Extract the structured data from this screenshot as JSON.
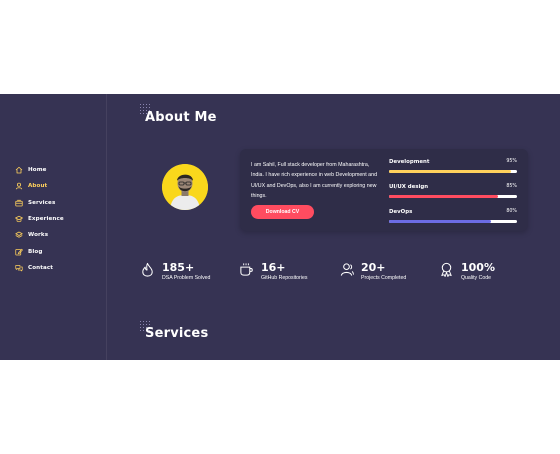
{
  "nav": {
    "items": [
      {
        "label": "Home",
        "icon": "house-icon",
        "active": false
      },
      {
        "label": "About",
        "icon": "user-icon",
        "active": true
      },
      {
        "label": "Services",
        "icon": "briefcase-icon",
        "active": false
      },
      {
        "label": "Experience",
        "icon": "graduation-cap-icon",
        "active": false
      },
      {
        "label": "Works",
        "icon": "layers-icon",
        "active": false
      },
      {
        "label": "Blog",
        "icon": "edit-icon",
        "active": false
      },
      {
        "label": "Contact",
        "icon": "chat-bubbles-icon",
        "active": false
      }
    ]
  },
  "about": {
    "title": "About Me",
    "bio": "I am Sahil, Full stack developer from Maharashtra, India. I have rich experience in web Development and UI/UX and DevOps, also I am currently exploring new things.",
    "cv_button": "Download CV",
    "skills": [
      {
        "name": "Development",
        "percent_label": "95%",
        "percent": 95,
        "color": "#ffd15c"
      },
      {
        "name": "UI/UX design",
        "percent_label": "85%",
        "percent": 85,
        "color": "#ff4c60"
      },
      {
        "name": "DevOps",
        "percent_label": "80%",
        "percent": 80,
        "color": "#6c6ce5"
      }
    ]
  },
  "stats": [
    {
      "value": "185+",
      "label": "DSA Problem Solved",
      "icon": "fire-icon"
    },
    {
      "value": "16+",
      "label": "GitHub Repositories",
      "icon": "coffee-cup-icon"
    },
    {
      "value": "20+",
      "label": "Projects Completed",
      "icon": "users-icon"
    },
    {
      "value": "100%",
      "label": "Quality Code",
      "icon": "award-badge-icon"
    }
  ],
  "services": {
    "title": "Services"
  },
  "colors": {
    "background": "#363353",
    "card": "#2f2d48",
    "accent_yellow": "#ffd15c",
    "accent_red": "#ff4c60",
    "accent_purple": "#6c6ce5",
    "avatar_bg": "#f9d71c"
  }
}
